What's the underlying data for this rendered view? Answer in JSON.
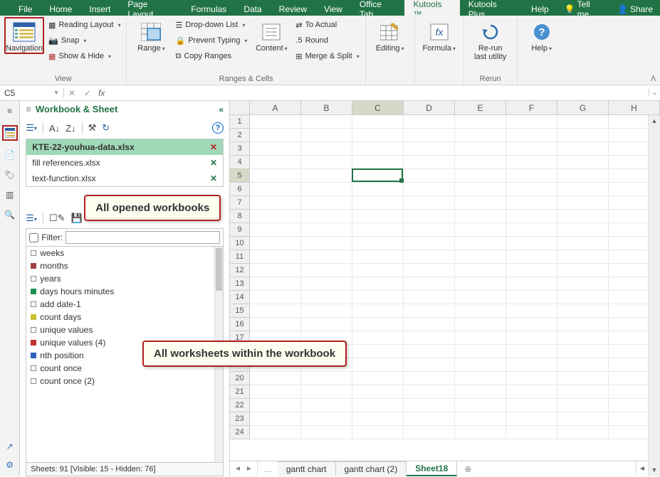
{
  "tabs": {
    "items": [
      "File",
      "Home",
      "Insert",
      "Page Layout",
      "Formulas",
      "Data",
      "Review",
      "View",
      "Office Tab",
      "Kutools ™",
      "Kutools Plus",
      "Help"
    ],
    "active_index": 9,
    "tell_me": "Tell me",
    "share": "Share"
  },
  "ribbon": {
    "navigation": "Navigation",
    "reading_layout": "Reading Layout",
    "snap": "Snap",
    "show_hide": "Show & Hide",
    "view_label": "View",
    "range": "Range",
    "dropdown_list": "Drop-down List",
    "prevent_typing": "Prevent Typing",
    "copy_ranges": "Copy Ranges",
    "content": "Content",
    "to_actual": "To Actual",
    "round": "Round",
    "merge_split": "Merge & Split",
    "ranges_cells_label": "Ranges & Cells",
    "editing": "Editing",
    "formula": "Formula",
    "rerun": "Re-run\nlast utility",
    "rerun_label": "Rerun",
    "help": "Help"
  },
  "formula_bar": {
    "name_box": "C5",
    "fx": "fx"
  },
  "nav": {
    "title": "Workbook & Sheet",
    "workbooks": [
      {
        "name": "KTE-22-youhua-data.xlsx",
        "active": true
      },
      {
        "name": "fill references.xlsx",
        "active": false
      },
      {
        "name": "text-function.xlsx",
        "active": false
      }
    ],
    "callout_wb": "All opened workbooks",
    "callout_ws": "All worksheets within the workbook",
    "filter_label": "Filter:",
    "worksheets": [
      {
        "name": "weeks",
        "color": "transparent"
      },
      {
        "name": "months",
        "color": "#a04040"
      },
      {
        "name": "years",
        "color": "transparent"
      },
      {
        "name": "days hours minutes",
        "color": "#209050"
      },
      {
        "name": "add date-1",
        "color": "transparent"
      },
      {
        "name": "count days",
        "color": "#c8c030"
      },
      {
        "name": "unique values",
        "color": "transparent"
      },
      {
        "name": "unique values (4)",
        "color": "#c03030"
      },
      {
        "name": "nth position",
        "color": "#3060c0"
      },
      {
        "name": "count once",
        "color": "transparent"
      },
      {
        "name": "count once (2)",
        "color": "transparent"
      }
    ],
    "status": "Sheets: 91  [Visible: 15 - Hidden: 76]"
  },
  "grid": {
    "columns": [
      "A",
      "B",
      "C",
      "D",
      "E",
      "F",
      "G",
      "H"
    ],
    "rows": 24,
    "selected_col": "C",
    "selected_row": 5
  },
  "sheet_tabs": {
    "tabs": [
      "gantt chart",
      "gantt chart (2)",
      "Sheet18"
    ],
    "active_index": 2
  }
}
